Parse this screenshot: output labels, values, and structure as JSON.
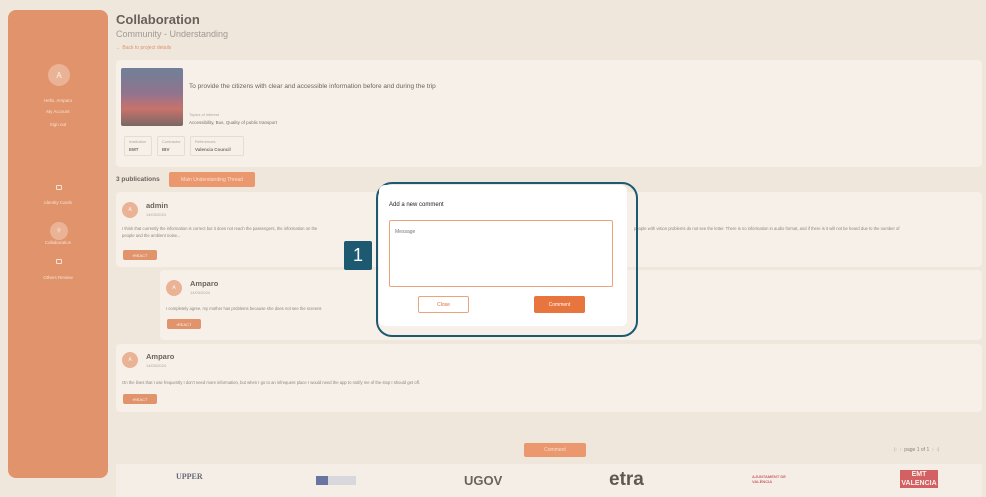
{
  "sidebar": {
    "avatar_initial": "A",
    "greeting": "Hello, Amparo",
    "my_account": "My Account",
    "sign_out": "Sign out",
    "nav_identity": "Identity Cards",
    "nav_collaboration": "Collaboration",
    "nav_deliverables": "Others Review"
  },
  "header": {
    "title": "Collaboration",
    "subtitle": "Community - Understanding",
    "back_link": "← Back to project details"
  },
  "project": {
    "title": "To provide the citizens with clear and accessible information before and during the trip",
    "topics_label": "Topics of interest",
    "topics_value": "Accessibility, Bus, Quality of public transport",
    "meta": [
      {
        "label": "Institution",
        "value": "EMT"
      },
      {
        "label": "Contractor",
        "value": "IBV"
      },
      {
        "label": "References",
        "value": "Valencia Council"
      }
    ]
  },
  "publications": {
    "count_label": "3 publications",
    "thread_button": "Main Understanding Thread"
  },
  "comments": [
    {
      "initial": "A",
      "name": "admin",
      "date": "14/03/2024",
      "text_line1": "I think that currently the information is correct but it does not reach the passengers, the information on the",
      "text_line1b": "people with vision problems do not see the letter. There is no information in audio format, and if there is it will not be heard due to the number of",
      "text_line2": "people and the ambient noise...",
      "react": "REACT"
    },
    {
      "initial": "A",
      "name": "Amparo",
      "date": "14/03/2024",
      "text_line1": "I completely agree, my mother has problems because she does not see the screens",
      "react": "REACT"
    },
    {
      "initial": "A",
      "name": "Amparo",
      "date": "14/03/2024",
      "text_line1": "On the lines that I use frequently I don't need more information, but when I go to an infrequent place I would need the app to notify me of the stop I should get off.",
      "react": "REACT"
    }
  ],
  "bottom_comment_button": "Comment",
  "pager": "page 1 of 1",
  "footer_logos": [
    "UPPER",
    "UGOV",
    "etra",
    "AJUNTAMENT DE VALÈNCIA",
    "EMT VALENCIA"
  ],
  "modal": {
    "title": "Add a new comment",
    "placeholder": "Message",
    "close": "Close",
    "comment": "Comment"
  },
  "step_marker": "1",
  "colors": {
    "accent": "#e8743e",
    "sidebar": "#d96c39",
    "marker": "#1d5a72"
  }
}
